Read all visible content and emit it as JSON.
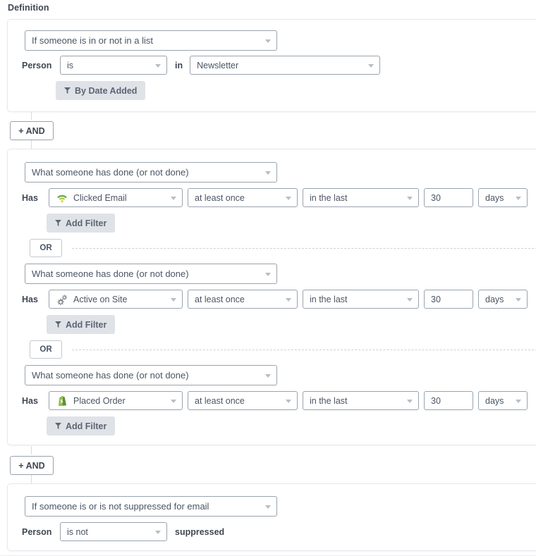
{
  "section": {
    "title": "Definition"
  },
  "connectors": {
    "and_label": "+ AND",
    "or_label": "OR"
  },
  "groups": [
    {
      "id": "list-membership",
      "condition_type": "If someone is in or not in a list",
      "subject_label": "Person",
      "operator": "is",
      "joiner_label": "in",
      "list_value": "Newsletter",
      "filter_button": "By Date Added",
      "filter_icon": "funnel-icon"
    },
    {
      "id": "activity-group",
      "rows": [
        {
          "condition_type": "What someone has done (or not done)",
          "verb_label": "Has",
          "metric": "Clicked Email",
          "metric_icon": "clicked-email-wifi-icon",
          "frequency": "at least once",
          "timeframe": "in the last",
          "amount": "30",
          "unit": "days",
          "add_filter": "Add Filter",
          "filter_icon": "funnel-icon"
        },
        {
          "condition_type": "What someone has done (or not done)",
          "verb_label": "Has",
          "metric": "Active on Site",
          "metric_icon": "gears-icon",
          "frequency": "at least once",
          "timeframe": "in the last",
          "amount": "30",
          "unit": "days",
          "add_filter": "Add Filter",
          "filter_icon": "funnel-icon"
        },
        {
          "condition_type": "What someone has done (or not done)",
          "verb_label": "Has",
          "metric": "Placed Order",
          "metric_icon": "shopify-bag-icon",
          "frequency": "at least once",
          "timeframe": "in the last",
          "amount": "30",
          "unit": "days",
          "add_filter": "Add Filter",
          "filter_icon": "funnel-icon"
        }
      ]
    },
    {
      "id": "suppression",
      "condition_type": "If someone is or is not suppressed for email",
      "subject_label": "Person",
      "operator": "is not",
      "suffix_label": "suppressed"
    }
  ],
  "colors": {
    "border": "#9aa3ad",
    "card_border": "#e6e8eb",
    "chip_bg": "#dfe3e8",
    "text": "#4a5564",
    "label": "#3f4752",
    "caret": "#b6bdc6",
    "shopify_green": "#95bf47",
    "wifi_green": "#5aa73c"
  }
}
